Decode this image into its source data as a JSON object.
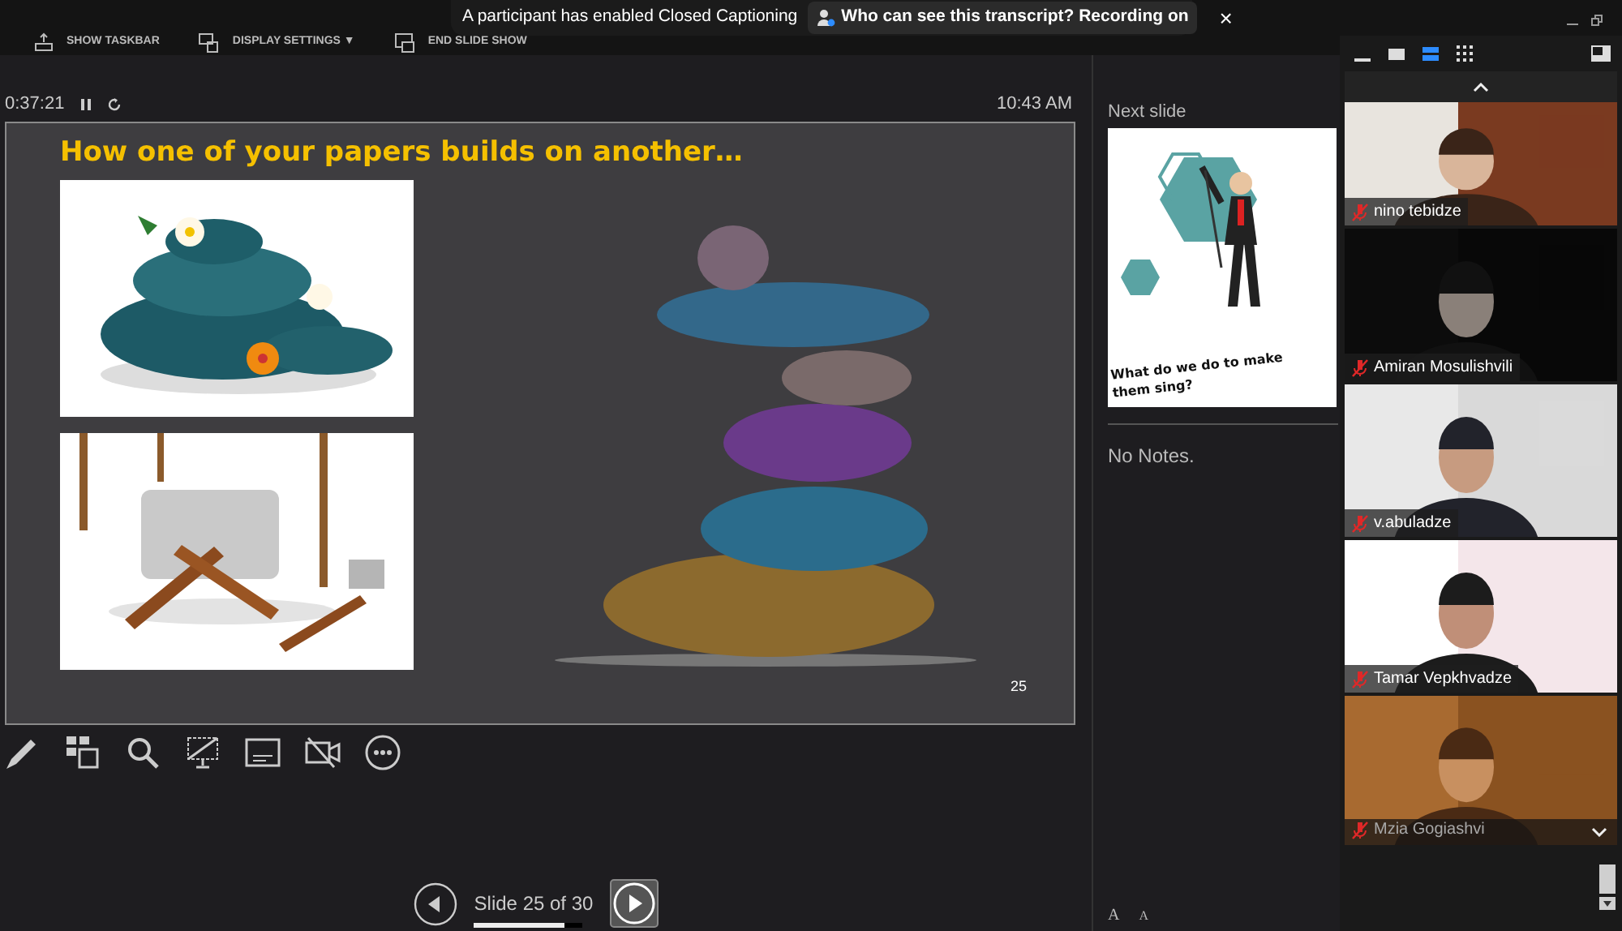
{
  "top_bar": {
    "buttons": [
      {
        "label": "SHOW TASKBAR"
      },
      {
        "label": "DISPLAY SETTINGS ▼"
      },
      {
        "label": "END SLIDE SHOW"
      }
    ]
  },
  "notification": {
    "message": "A participant has enabled Closed Captioning",
    "link": "Who can see this transcript? Recording on",
    "close": "×"
  },
  "presenter": {
    "timer": "0:37:21",
    "clock": "10:43 AM",
    "slide": {
      "title": "How one of your papers builds on another…",
      "page": "25"
    },
    "navigation": {
      "label": "Slide 25 of 30",
      "level": 0.83
    }
  },
  "next_slide": {
    "heading": "Next slide",
    "caption": "What do we do to make them sing?",
    "notes": "No Notes."
  },
  "font_buttons": [
    "A",
    "A"
  ],
  "participants": [
    {
      "name": "nino tebidze",
      "muted": true
    },
    {
      "name": "Amiran Mosulishvili",
      "muted": true
    },
    {
      "name": "v.abuladze",
      "muted": true
    },
    {
      "name": "Tamar Vepkhvadze",
      "muted": true
    },
    {
      "name": "Mzia Gogiashvi",
      "muted": true
    }
  ]
}
